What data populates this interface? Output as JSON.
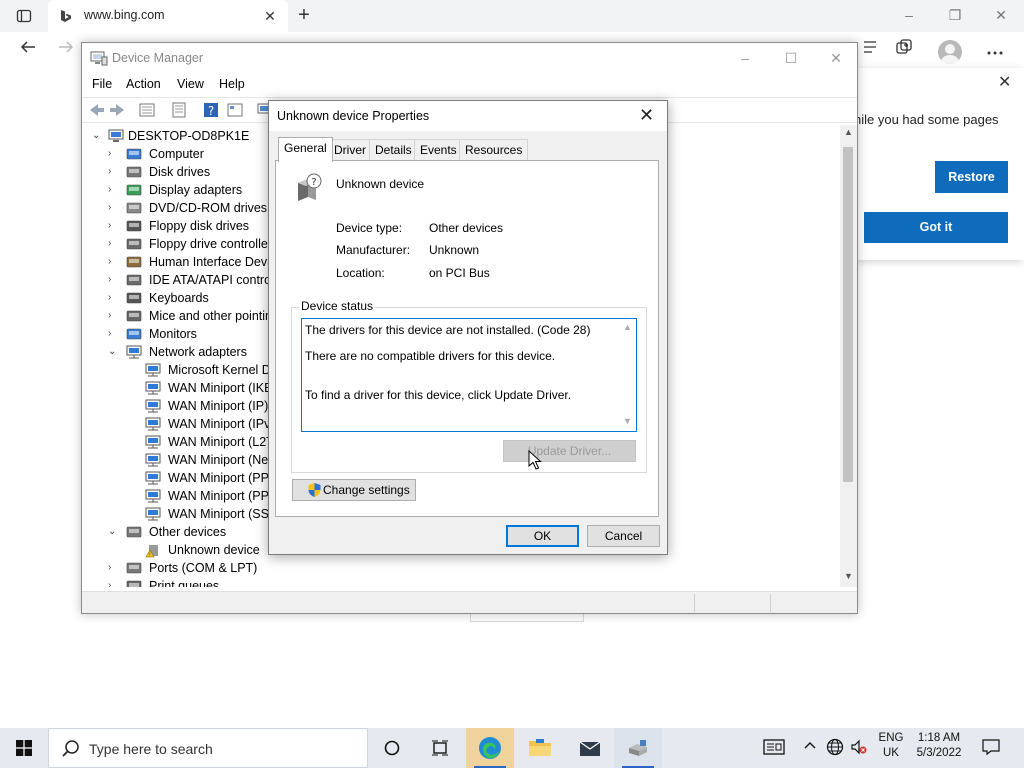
{
  "browser": {
    "tab_title": "www.bing.com",
    "tab_close": "✕",
    "new_tab": "+",
    "window_controls": [
      "–",
      "❐",
      "✕"
    ]
  },
  "restore_popup": {
    "message": "hile you had some pages",
    "restore_label": "Restore",
    "gotit_label": "Got it",
    "close": "✕"
  },
  "device_manager": {
    "title": "Device Manager",
    "controls": [
      "–",
      "☐",
      "✕"
    ],
    "menu": [
      "File",
      "Action",
      "View",
      "Help"
    ],
    "tree": {
      "root": "DESKTOP-OD8PK1E",
      "items": [
        {
          "label": "Computer",
          "level": 1,
          "icon": "monitor-icon",
          "expanded": false
        },
        {
          "label": "Disk drives",
          "level": 1,
          "icon": "disk-icon",
          "expanded": false
        },
        {
          "label": "Display adapters",
          "level": 1,
          "icon": "display-icon",
          "expanded": false
        },
        {
          "label": "DVD/CD-ROM drives",
          "level": 1,
          "icon": "dvd-icon",
          "expanded": false
        },
        {
          "label": "Floppy disk drives",
          "level": 1,
          "icon": "floppy-icon",
          "expanded": false
        },
        {
          "label": "Floppy drive controllers",
          "level": 1,
          "icon": "controller-icon",
          "expanded": false
        },
        {
          "label": "Human Interface Devic",
          "level": 1,
          "icon": "hid-icon",
          "expanded": false
        },
        {
          "label": "IDE ATA/ATAPI controlle",
          "level": 1,
          "icon": "controller-icon",
          "expanded": false
        },
        {
          "label": "Keyboards",
          "level": 1,
          "icon": "keyboard-icon",
          "expanded": false
        },
        {
          "label": "Mice and other pointing",
          "level": 1,
          "icon": "mouse-icon",
          "expanded": false
        },
        {
          "label": "Monitors",
          "level": 1,
          "icon": "monitor-icon",
          "expanded": false
        },
        {
          "label": "Network adapters",
          "level": 1,
          "icon": "network-icon",
          "expanded": true
        },
        {
          "label": "Microsoft Kernel De",
          "level": 2,
          "icon": "network-icon"
        },
        {
          "label": "WAN Miniport (IKEv",
          "level": 2,
          "icon": "network-icon"
        },
        {
          "label": "WAN Miniport (IP)",
          "level": 2,
          "icon": "network-icon"
        },
        {
          "label": "WAN Miniport (IPv6",
          "level": 2,
          "icon": "network-icon"
        },
        {
          "label": "WAN Miniport (L2T",
          "level": 2,
          "icon": "network-icon"
        },
        {
          "label": "WAN Miniport (Net",
          "level": 2,
          "icon": "network-icon"
        },
        {
          "label": "WAN Miniport (PPP",
          "level": 2,
          "icon": "network-icon"
        },
        {
          "label": "WAN Miniport (PPT",
          "level": 2,
          "icon": "network-icon"
        },
        {
          "label": "WAN Miniport (SST",
          "level": 2,
          "icon": "network-icon"
        },
        {
          "label": "Other devices",
          "level": 1,
          "icon": "other-devices-icon",
          "expanded": true
        },
        {
          "label": "Unknown device",
          "level": 2,
          "icon": "warning-device-icon"
        },
        {
          "label": "Ports (COM & LPT)",
          "level": 1,
          "icon": "port-icon",
          "expanded": false
        },
        {
          "label": "Print queues",
          "level": 1,
          "icon": "printer-icon",
          "expanded": false
        }
      ]
    }
  },
  "properties_dialog": {
    "title": "Unknown device Properties",
    "close": "✕",
    "tabs": [
      "General",
      "Driver",
      "Details",
      "Events",
      "Resources"
    ],
    "active_tab": "General",
    "device_name": "Unknown device",
    "fields": [
      {
        "label": "Device type:",
        "value": "Other devices"
      },
      {
        "label": "Manufacturer:",
        "value": "Unknown"
      },
      {
        "label": "Location:",
        "value": "on PCI Bus"
      }
    ],
    "status_group_label": "Device status",
    "status_lines": [
      "The drivers for this device are not installed. (Code 28)",
      "There are no compatible drivers for this device.",
      "To find a driver for this device, click Update Driver."
    ],
    "update_driver_label": "Update Driver...",
    "change_settings_label": "Change settings",
    "ok_label": "OK",
    "cancel_label": "Cancel"
  },
  "taskbar": {
    "search_placeholder": "Type here to search",
    "language": "ENG",
    "region": "UK",
    "time": "1:18 AM",
    "date": "5/3/2022"
  },
  "colors": {
    "edge_blue": "#0f6cbd",
    "focus_blue": "#0078d7",
    "taskbar_bg": "#e6eaf0"
  }
}
